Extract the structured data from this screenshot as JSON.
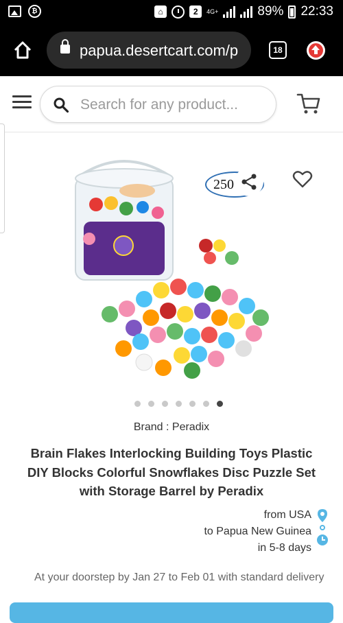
{
  "status_bar": {
    "sim_badge": "2",
    "network": "4G+",
    "battery": "89%",
    "time": "22:33"
  },
  "browser": {
    "url": "papua.desertcart.com/p",
    "tab_count": "18"
  },
  "header": {
    "search_placeholder": "Search for any product..."
  },
  "product": {
    "badge_text": "250",
    "image_count": 7,
    "active_image_index": 6,
    "brand_line": "Brand : Peradix",
    "title": "Brain Flakes Interlocking Building Toys Plastic DIY Blocks Colorful Snowflakes Disc Puzzle Set with Storage Barrel by Peradix"
  },
  "shipping": {
    "from": "from USA",
    "to": "to Papua New Guinea",
    "eta": "in 5-8 days",
    "delivery_note": "At your doorstep by Jan 27  to Feb 01 with standard delivery"
  },
  "colors": {
    "accent": "#56b6e4",
    "badge_border": "#2f6fb3",
    "upload_red": "#e53935"
  }
}
